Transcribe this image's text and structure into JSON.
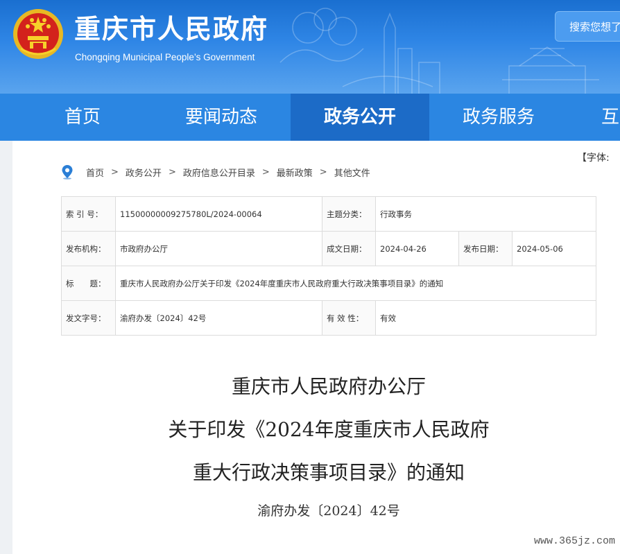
{
  "header": {
    "title": "重庆市人民政府",
    "subtitle": "Chongqing Municipal People’s Government",
    "search_placeholder": "搜索您想了",
    "colors": {
      "primary": "#2b86e2",
      "active": "#1c6bc7"
    }
  },
  "nav": {
    "items": [
      "首页",
      "要闻动态",
      "政务公开",
      "政务服务",
      "互"
    ],
    "active": "政务公开"
  },
  "font_size_label": "【字体:",
  "breadcrumb": [
    "首页",
    "政务公开",
    "政府信息公开目录",
    "最新政策",
    "其他文件"
  ],
  "info": {
    "index_label": "索 引 号：",
    "index_value": "11500000009275780L/2024-00064",
    "topic_label": "主题分类：",
    "topic_value": "行政事务",
    "issuer_label": "发布机构：",
    "issuer_value": "市政府办公厅",
    "written_label": "成文日期：",
    "written_value": "2024-04-26",
    "published_label": "发布日期：",
    "published_value": "2024-05-06",
    "title_label": "标　　题：",
    "title_value": "重庆市人民政府办公厅关于印发《2024年度重庆市人民政府重大行政决策事项目录》的通知",
    "doc_no_label": "发文字号：",
    "doc_no_value": "渝府办发〔2024〕42号",
    "validity_label": "有 效 性：",
    "validity_value": "有效"
  },
  "document": {
    "line1": "重庆市人民政府办公厅",
    "line2": "关于印发《2024年度重庆市人民政府",
    "line3": "重大行政决策事项目录》的通知",
    "doc_number": "渝府办发〔2024〕42号"
  },
  "watermark": "www.365jz.com"
}
